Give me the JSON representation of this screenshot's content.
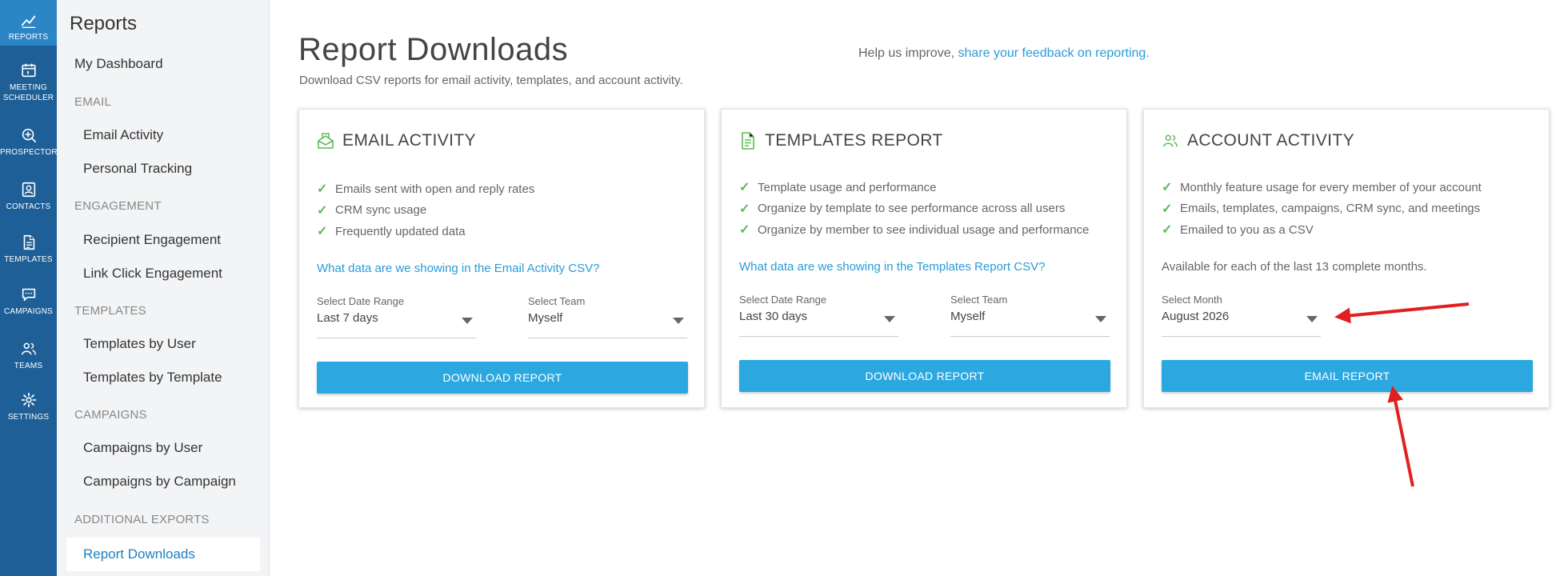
{
  "rail": {
    "reports": {
      "label": "REPORTS",
      "icon": "chart-line-icon"
    },
    "meeting": {
      "label_line1": "MEETING",
      "label_line2": "SCHEDULER",
      "icon": "calendar-icon"
    },
    "prospector": {
      "label": "PROSPECTOR",
      "icon": "magnifier-plus-icon"
    },
    "contacts": {
      "label": "CONTACTS",
      "icon": "contact-card-icon"
    },
    "templates": {
      "label": "TEMPLATES",
      "icon": "document-icon"
    },
    "campaigns": {
      "label": "CAMPAIGNS",
      "icon": "chat-bubble-icon"
    },
    "teams": {
      "label": "TEAMS",
      "icon": "people-icon"
    },
    "settings": {
      "label": "SETTINGS",
      "icon": "gear-icon"
    }
  },
  "sidebar": {
    "title": "Reports",
    "dashboard": "My Dashboard",
    "email_section": "EMAIL",
    "email_activity": "Email Activity",
    "personal_tracking": "Personal Tracking",
    "engagement_section": "ENGAGEMENT",
    "recipient_engagement": "Recipient Engagement",
    "link_click_engagement": "Link Click Engagement",
    "templates_section": "TEMPLATES",
    "templates_by_user": "Templates by User",
    "templates_by_template": "Templates by Template",
    "campaigns_section": "CAMPAIGNS",
    "campaigns_by_user": "Campaigns by User",
    "campaigns_by_campaign": "Campaigns by Campaign",
    "additional_section": "ADDITIONAL EXPORTS",
    "report_downloads": "Report Downloads"
  },
  "header": {
    "title": "Report Downloads",
    "subtitle": "Download CSV reports for email activity, templates, and account activity.",
    "feedback_prefix": "Help us improve,",
    "feedback_link": "share your feedback on reporting."
  },
  "cards": {
    "email": {
      "title": "EMAIL ACTIVITY",
      "bullets": [
        "Emails sent with open and reply rates",
        "CRM sync usage",
        "Frequently updated data"
      ],
      "help": "What data are we showing in the Email Activity CSV?",
      "date_label": "Select Date Range",
      "date_value": "Last 7 days",
      "team_label": "Select Team",
      "team_value": "Myself",
      "button": "DOWNLOAD REPORT"
    },
    "templates": {
      "title": "TEMPLATES REPORT",
      "bullets": [
        "Template usage and performance",
        "Organize by template to see performance across all users",
        "Organize by member to see individual usage and performance"
      ],
      "help": "What data are we showing in the Templates Report CSV?",
      "date_label": "Select Date Range",
      "date_value": "Last 30 days",
      "team_label": "Select Team",
      "team_value": "Myself",
      "button": "DOWNLOAD REPORT"
    },
    "account": {
      "title": "ACCOUNT ACTIVITY",
      "bullets": [
        "Monthly feature usage for every member of your account",
        "Emails, templates, campaigns, CRM sync, and meetings",
        "Emailed to you as a CSV"
      ],
      "note": "Available for each of the last 13 complete months.",
      "month_label": "Select Month",
      "month_value": "August 2026",
      "button": "EMAIL REPORT"
    }
  },
  "colors": {
    "rail": "#1d5f96",
    "rail_active": "#2c86c6",
    "button": "#2ca8e0",
    "link": "#2b9bd8",
    "check": "#5cb85c",
    "annotation_arrow": "#e02020"
  }
}
